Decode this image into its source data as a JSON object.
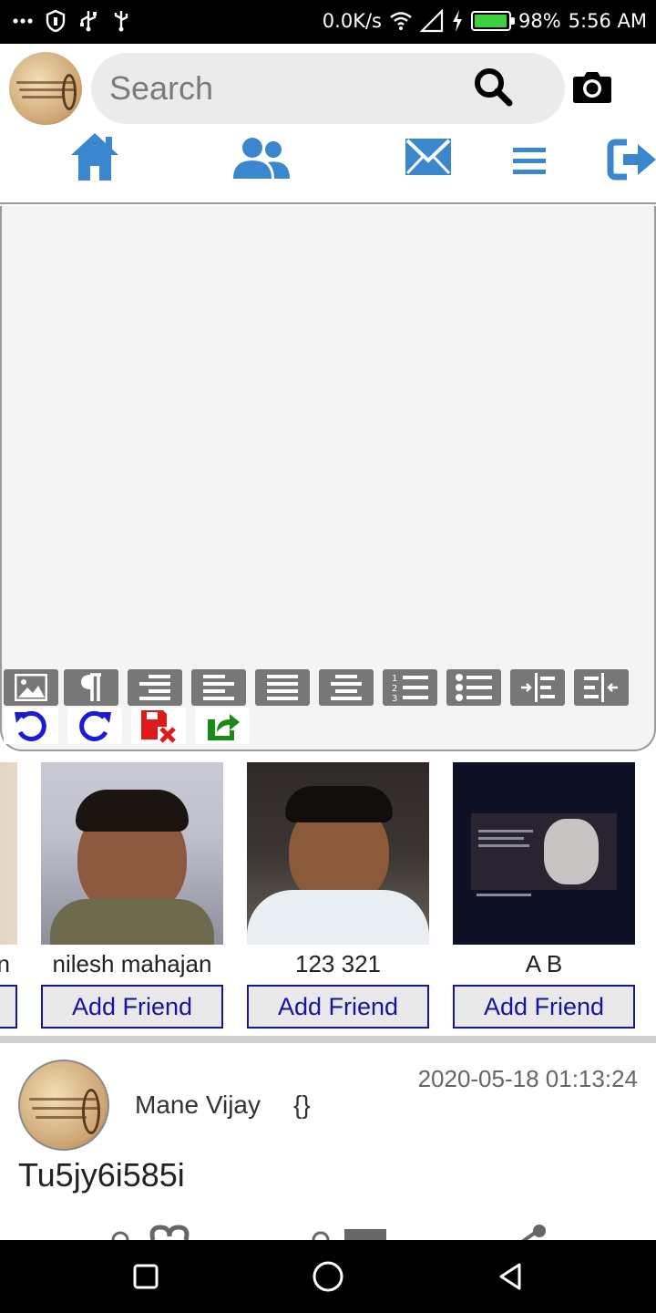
{
  "status_bar": {
    "network_speed": "0.0K/s",
    "battery": "98%",
    "battery_level": 0.98,
    "time": "5:56 AM",
    "icons": [
      "more-icon",
      "shield-icon",
      "usb-icon",
      "usb-icon",
      "wifi-icon",
      "signal-icon",
      "charging-icon",
      "battery-icon"
    ]
  },
  "header": {
    "search_placeholder": "Search",
    "icons": [
      "profile-avatar",
      "search-icon",
      "camera-icon"
    ]
  },
  "nav": {
    "items": [
      "home-icon",
      "friends-icon",
      "messages-icon",
      "menu-icon",
      "logout-icon"
    ],
    "accent": "#3a86cf"
  },
  "editor": {
    "toolbar_row1": [
      "image-icon",
      "paragraph-icon",
      "align-right-icon",
      "align-left-icon",
      "justify-icon",
      "align-center-icon",
      "ordered-list-icon",
      "unordered-list-icon",
      "indent-icon",
      "outdent-icon"
    ],
    "toolbar_row2": [
      "undo-icon",
      "redo-icon",
      "discard-icon",
      "share-icon"
    ]
  },
  "suggestions": {
    "partial_name": "n",
    "people": [
      {
        "name": "nilesh mahajan",
        "button": "Add Friend"
      },
      {
        "name": "123 321",
        "button": "Add Friend"
      },
      {
        "name": "A B",
        "button": "Add Friend"
      }
    ]
  },
  "post": {
    "author": "Mane Vijay",
    "braces": "{}",
    "timestamp": "2020-05-18 01:13:24",
    "text": "Tu5jy6i585i"
  },
  "colors": {
    "nav_blue": "#3a86cf",
    "button_border": "#1515a0",
    "toolbar_gray": "#777777",
    "undo_blue": "#1a1ad8",
    "discard_red": "#e01a1a",
    "share_green": "#1a8a1a"
  }
}
